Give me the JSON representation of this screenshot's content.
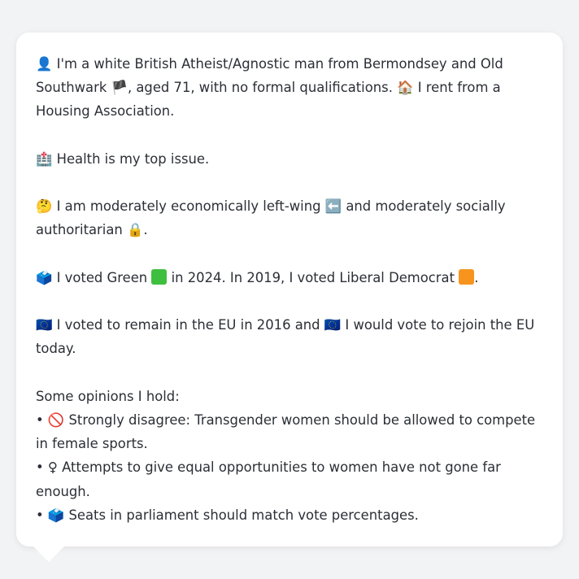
{
  "profile": {
    "intro_icon": "👤",
    "intro_text_1": " I'm a white British Atheist/Agnostic man from Bermondsey and Old Southwark ",
    "flag_icon": "🏴",
    "intro_text_2": ", aged 71, with no formal qualifications. ",
    "home_icon": "🏠",
    "intro_text_3": " I rent from a Housing Association.",
    "health_icon": "🏥",
    "health_text": " Health is my top issue.",
    "think_icon": "🤔",
    "economic_text_1": " I am moderately economically left-wing ",
    "left_arrow_icon": "⬅️",
    "economic_text_2": " and moderately socially authoritarian ",
    "lock_icon": "🔒",
    "economic_text_3": ".",
    "ballot_icon": "🗳️",
    "vote_text_1": " I voted Green ",
    "green_color": "#3fbf3f",
    "vote_text_2": " in 2024. In 2019, I voted Liberal Democrat ",
    "orange_color": "#f7941d",
    "vote_text_3": ".",
    "eu_icon": "🇪🇺",
    "eu_text_1": " I voted to remain in the EU in 2016 and ",
    "eu_icon_2": "🇪🇺",
    "eu_text_2": " I would vote to rejoin the EU today.",
    "opinions_heading": "Some opinions I hold:",
    "opinions": [
      {
        "bullet": "• ",
        "icon": "🚫",
        "text": " Strongly disagree: Transgender women should be allowed to compete in female sports."
      },
      {
        "bullet": "• ",
        "icon": "♀",
        "text": "  Attempts to give equal opportunities to women have not gone far enough."
      },
      {
        "bullet": "• ",
        "icon": "🗳️",
        "text": " Seats in parliament should match vote percentages."
      }
    ]
  }
}
